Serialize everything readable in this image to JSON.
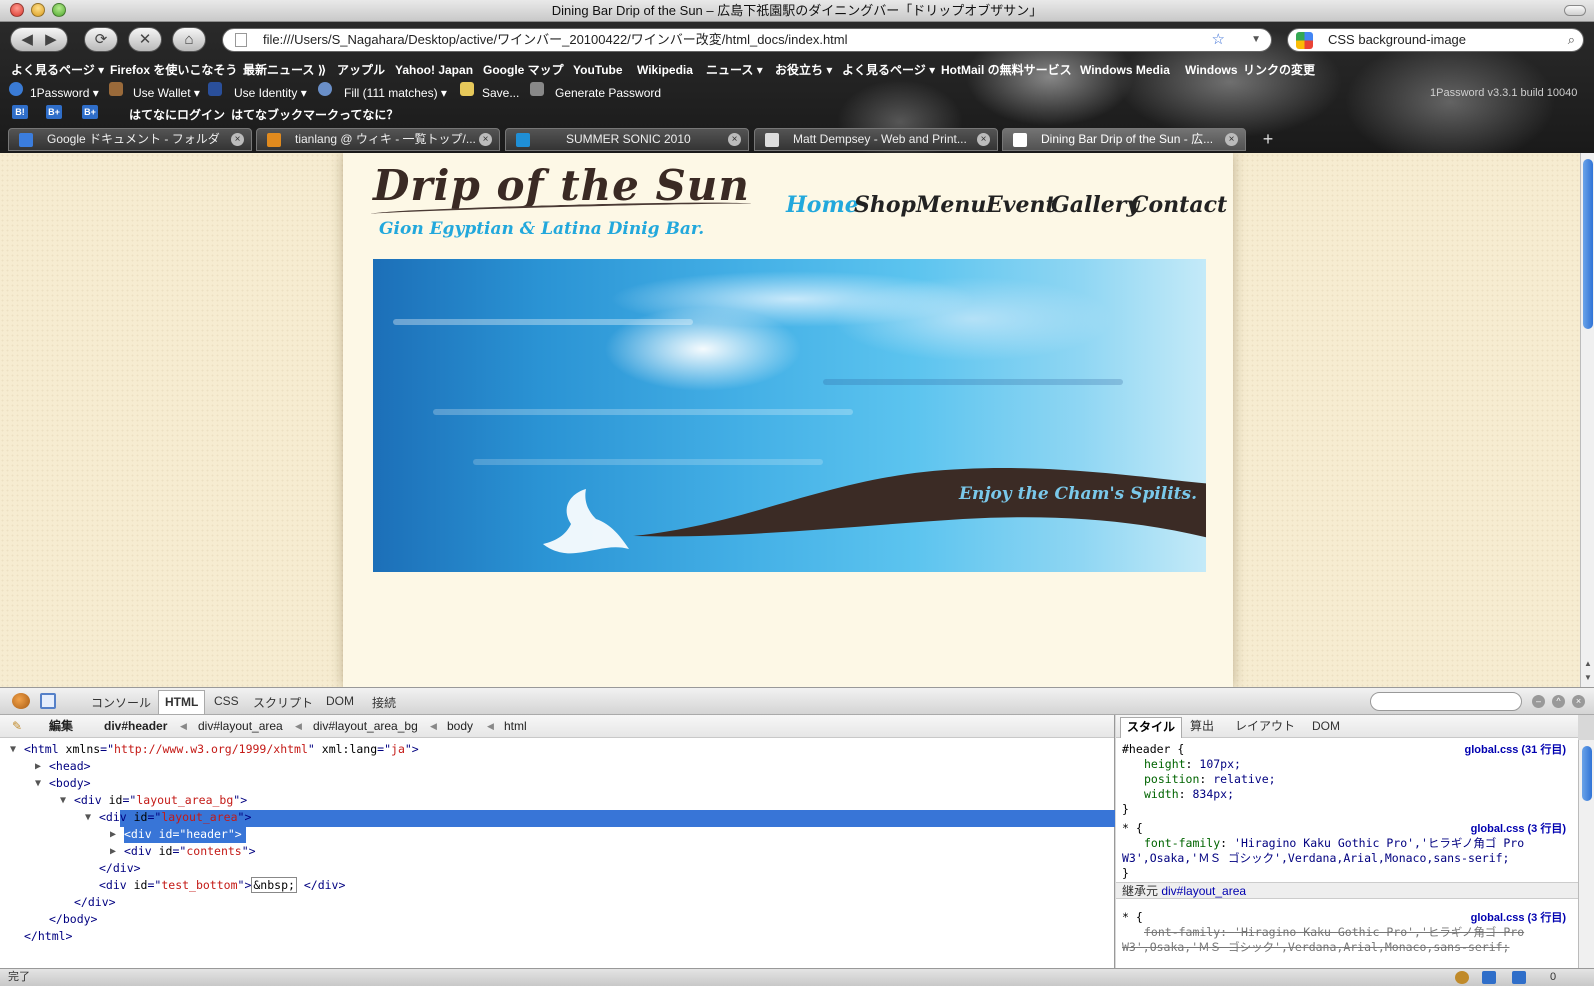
{
  "window": {
    "title": "Dining Bar Drip of the Sun – 広島下祇園駅のダイニングバー「ドリップオブザサン」"
  },
  "nav": {
    "back": "◀",
    "forward": "▶",
    "reload": "⟳",
    "stop": "✕",
    "home": "⌂",
    "url": "file:///Users/S_Nagahara/Desktop/active/ワインバー_20100422/ワインバー改変/html_docs/index.html",
    "search": "CSS background-image"
  },
  "bookmarks": [
    "よく見るページ ▾",
    "Firefox を使いこなそう",
    "最新ニュース ⟫",
    "アップル",
    "Yahoo! Japan",
    "Google マップ",
    "YouTube",
    "Wikipedia",
    "ニュース ▾",
    "お役立ち ▾",
    "よく見るページ ▾",
    "HotMail の無料サービス",
    "Windows Media",
    "Windows",
    "リンクの変更"
  ],
  "onepassword": {
    "main": "1Password ▾",
    "wallet": "Use Wallet ▾",
    "identity": "Use Identity ▾",
    "fill": "Fill (111 matches) ▾",
    "save": "Save...",
    "generate": "Generate Password",
    "version": "1Password v3.3.1 build 10040"
  },
  "hatena": {
    "login": "はてなにログイン",
    "about": "はてなブックマークってなに？"
  },
  "tabs": [
    {
      "label": "Google ドキュメント - フォルダ",
      "color": "#3b7ddd"
    },
    {
      "label": "tianlang @ ウィキ - 一覧トップ/...",
      "color": "#e08a1e"
    },
    {
      "label": "SUMMER SONIC 2010",
      "color": "#1f8fd6"
    },
    {
      "label": "Matt Dempsey - Web and Print...",
      "color": "#dddddd"
    },
    {
      "label": "Dining Bar Drip of the Sun - 広...",
      "color": "#ffffff"
    }
  ],
  "site": {
    "logo": "Drip of the Sun",
    "tagline": "Gion Egyptian & Latina Dinig Bar.",
    "menu": [
      "Home",
      "Shop",
      "Menu",
      "Event",
      "Gallery",
      "Contact"
    ],
    "active_menu": "Home",
    "slogan": "Enjoy the Cham's Spilits.",
    "accent": "#22a8dc",
    "dark_brown": "#3a2a24"
  },
  "firebug": {
    "tabs": [
      "コンソール",
      "HTML",
      "CSS",
      "スクリプト",
      "DOM",
      "接続"
    ],
    "active_tab": "HTML",
    "edit": "編集",
    "breadcrumbs": [
      "div#header",
      "div#layout_area",
      "div#layout_area_bg",
      "body",
      "html"
    ],
    "tree": {
      "l1a": "<html ",
      "l1b": "xmlns",
      "l1c": "=\"",
      "l1d": "http://www.w3.org/1999/xhtml",
      "l1e": "\" ",
      "l1f": "xml:lang",
      "l1g": "=\"",
      "l1h": "ja",
      "l1i": "\">",
      "l2": "<head>",
      "l3": "<body>",
      "l4a": "<div ",
      "l4b": "id",
      "l4c": "=\"",
      "l4d": "layout_area_bg",
      "l4e": "\">",
      "l5a": "<div ",
      "l5b": "id",
      "l5c": "=\"",
      "l5d": "layout_area",
      "l5e": "\">",
      "l6": "<div id=\"header\">",
      "l7a": "<div ",
      "l7b": "id",
      "l7c": "=\"",
      "l7d": "contents",
      "l7e": "\">",
      "l8": "</div>",
      "l9a": "<div ",
      "l9b": "id",
      "l9c": "=\"",
      "l9d": "test_bottom",
      "l9e": "\">",
      "l9f": "&nbsp;",
      "l9g": " </div>",
      "l10": "</div>",
      "l11": "</body>",
      "l12": "</html>"
    },
    "side_tabs": [
      "スタイル",
      "算出",
      "レイアウト",
      "DOM"
    ],
    "active_side_tab": "スタイル",
    "css": {
      "r1_sel": "#header {",
      "r1_src": "global.css (31 行目)",
      "r1_p1n": "height",
      "r1_p1v": "107px;",
      "r1_p2n": "position",
      "r1_p2v": "relative;",
      "r1_p3n": "width",
      "r1_p3v": "834px;",
      "close": "}",
      "r2_sel": "* {",
      "r2_src": "global.css (3 行目)",
      "r2_p1n": "font-family",
      "r2_p1v": "'Hiragino Kaku Gothic Pro','ヒラギノ角ゴ Pro",
      "r2_p1v2": "W3',Osaka,'ＭＳ ゴシック',Verdana,Arial,Monaco,sans-serif;",
      "inherit_label": "継承元 ",
      "inherit_link": "div#layout_area",
      "r3_sel": "* {",
      "r3_src": "global.css (3 行目)"
    }
  },
  "status": {
    "text": "完了",
    "count": "0"
  }
}
